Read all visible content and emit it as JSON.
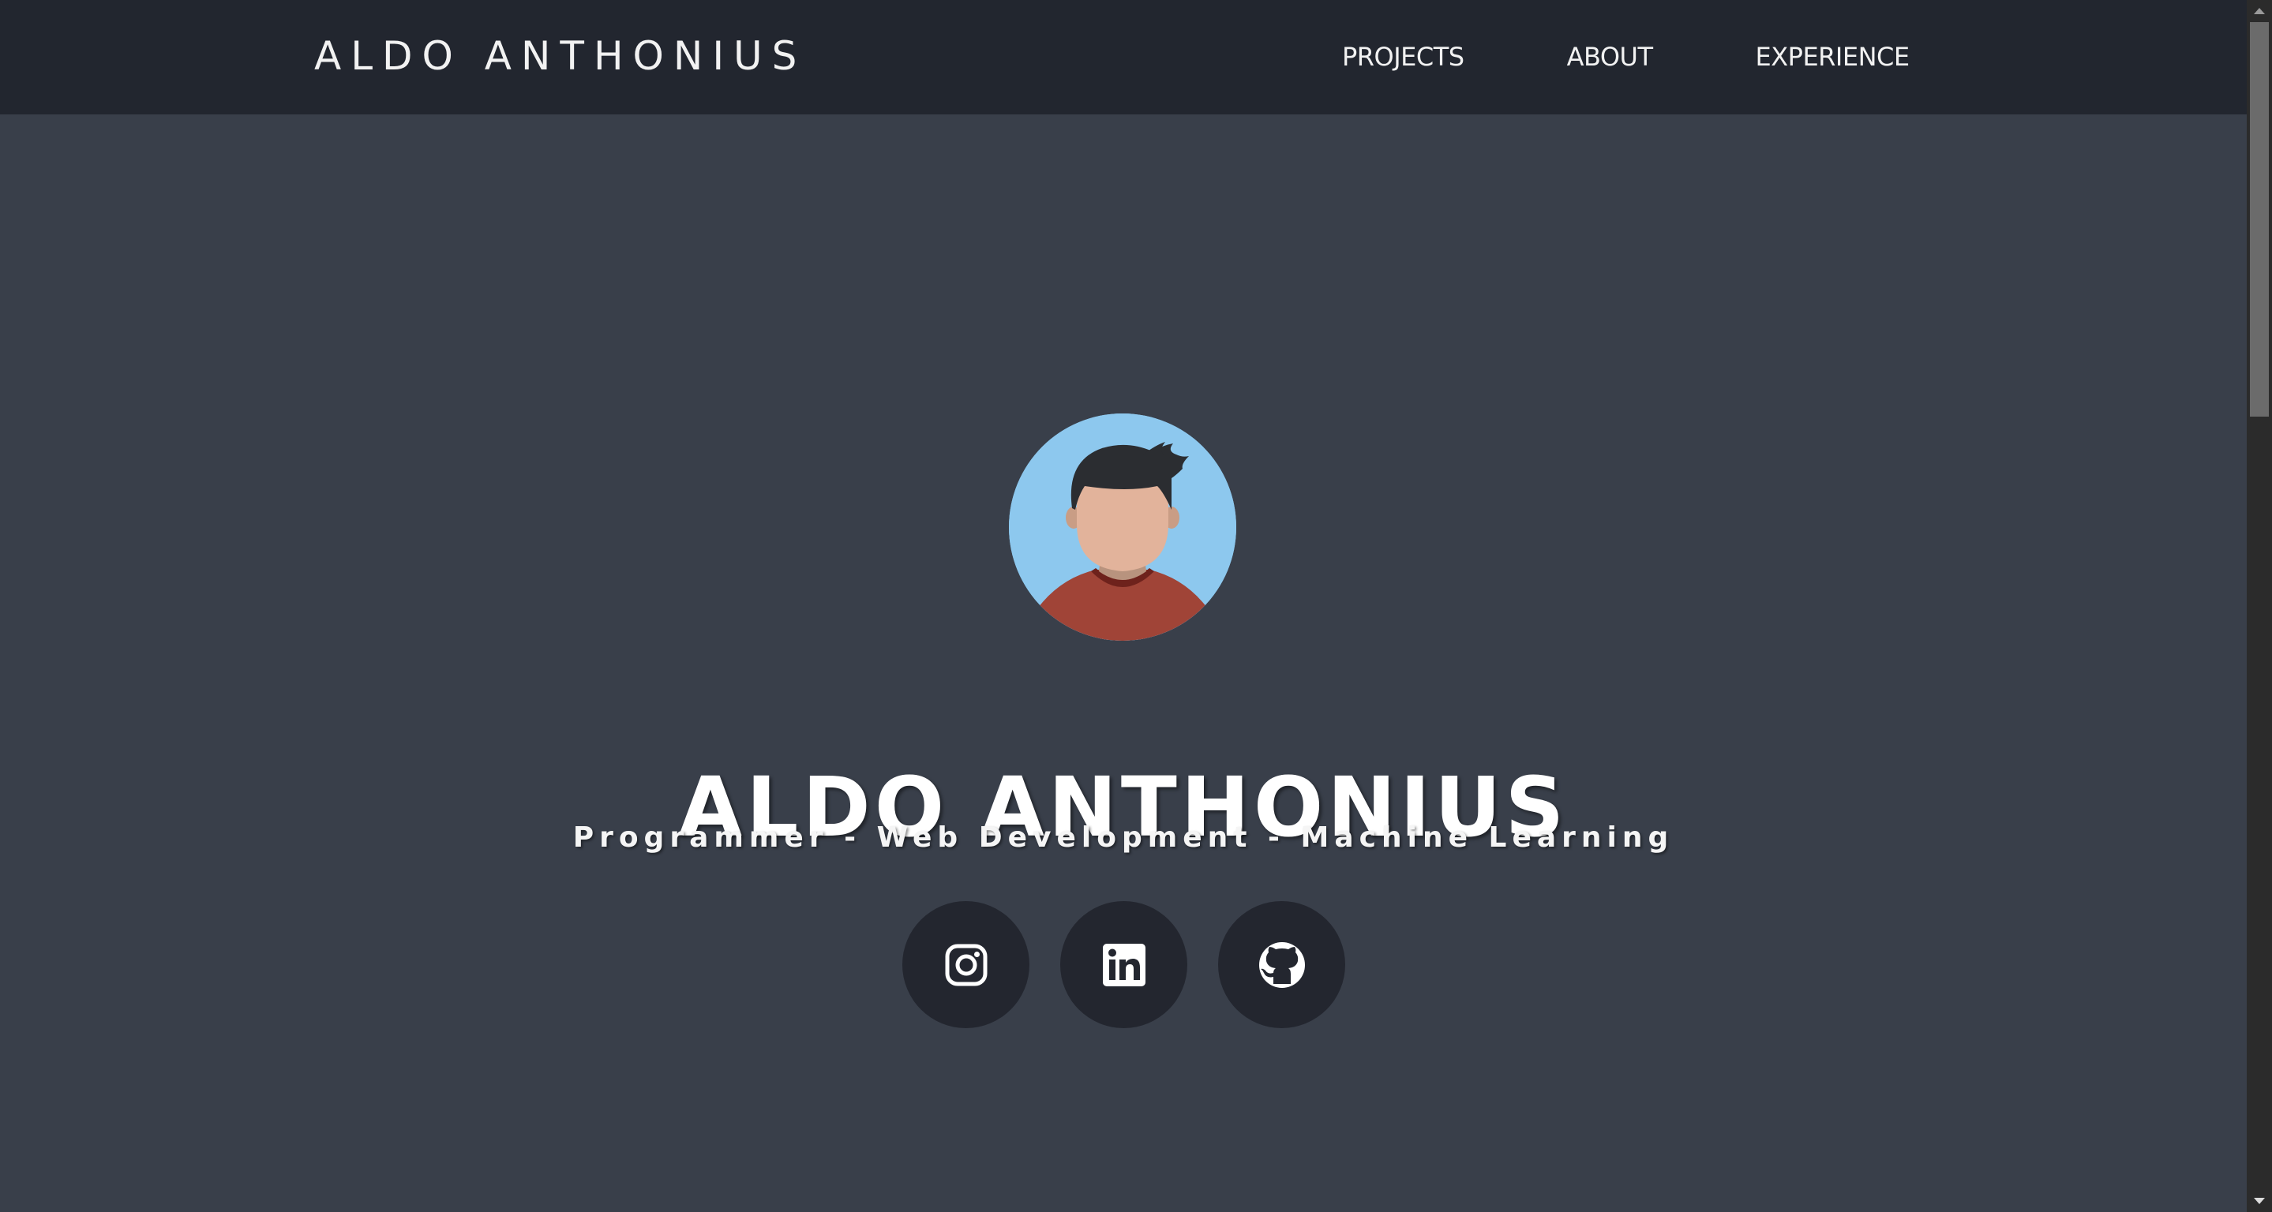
{
  "navbar": {
    "brand": "ALDO ANTHONIUS",
    "links": [
      {
        "label": "PROJECTS"
      },
      {
        "label": "ABOUT"
      },
      {
        "label": "EXPERIENCE"
      }
    ]
  },
  "hero": {
    "avatar_icon": "avatar-illustration",
    "title": "ALDO ANTHONIUS",
    "subtitle": "Programmer - Web Development - Machine Learning",
    "socials": [
      {
        "icon": "instagram-icon"
      },
      {
        "icon": "linkedin-icon"
      },
      {
        "icon": "github-icon"
      }
    ]
  },
  "colors": {
    "navbar_bg": "#22262f",
    "page_bg": "#393f4a",
    "social_button_bg": "#23262f",
    "avatar_bg": "#8dc8ee",
    "text": "#ffffff"
  }
}
